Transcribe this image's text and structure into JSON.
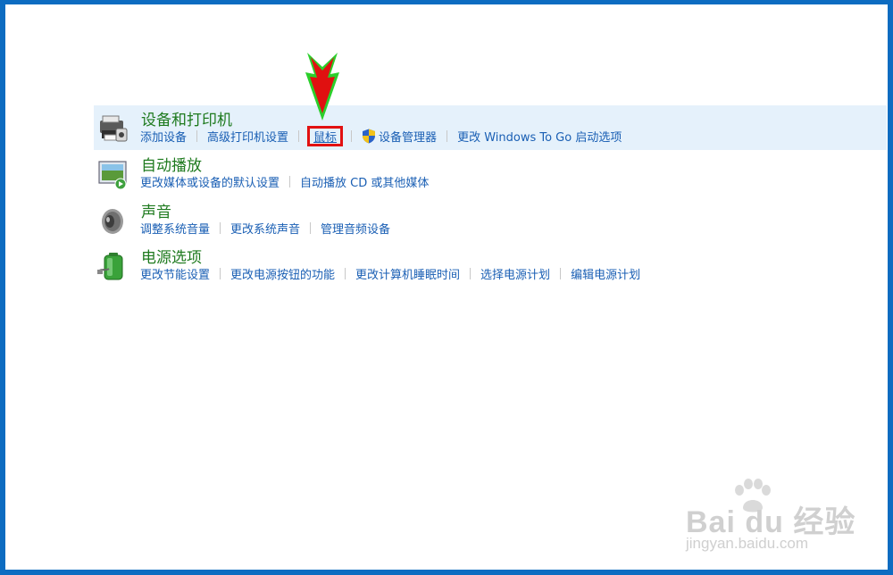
{
  "sections": [
    {
      "title": "设备和打印机",
      "icon": "printer-icon",
      "links": [
        "添加设备",
        "高级打印机设置",
        "鼠标",
        "设备管理器",
        "更改 Windows To Go 启动选项"
      ]
    },
    {
      "title": "自动播放",
      "icon": "autoplay-icon",
      "links": [
        "更改媒体或设备的默认设置",
        "自动播放 CD 或其他媒体"
      ]
    },
    {
      "title": "声音",
      "icon": "speaker-icon",
      "links": [
        "调整系统音量",
        "更改系统声音",
        "管理音频设备"
      ]
    },
    {
      "title": "电源选项",
      "icon": "battery-icon",
      "links": [
        "更改节能设置",
        "更改电源按钮的功能",
        "更改计算机睡眠时间",
        "选择电源计划",
        "编辑电源计划"
      ]
    }
  ],
  "watermark": {
    "main": "Bai du 经验",
    "sub": "jingyan.baidu.com"
  },
  "colors": {
    "title_green": "#1e7a1e",
    "link_blue": "#1a5fb4",
    "hover_bg": "#e5f1fb",
    "frame_blue": "#0d6cc1",
    "highlight_red": "#e21111"
  }
}
